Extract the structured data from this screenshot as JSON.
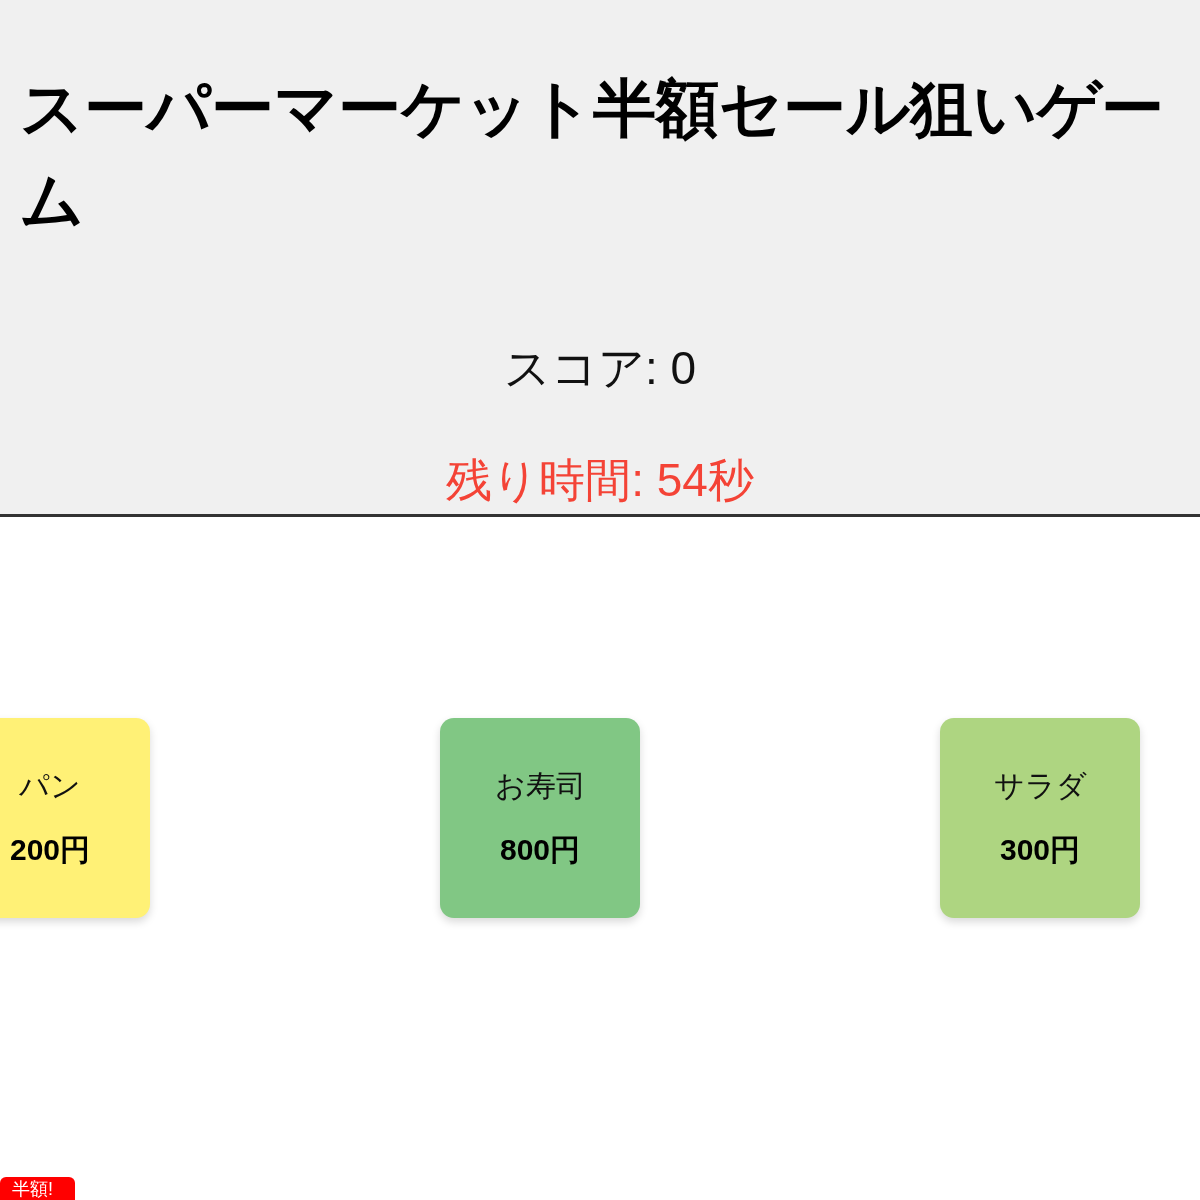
{
  "title": "スーパーマーケット半額セール狙いゲーム",
  "score": "スコア: 0",
  "timer": "残り時間: 54秒",
  "items": [
    {
      "name": "パン",
      "price": "200円",
      "color": "#fff176"
    },
    {
      "name": "お寿司",
      "price": "800円",
      "color": "#81c784"
    },
    {
      "name": "サラダ",
      "price": "300円",
      "color": "#aed581"
    }
  ],
  "sale_tag": {
    "label": "半額!"
  }
}
